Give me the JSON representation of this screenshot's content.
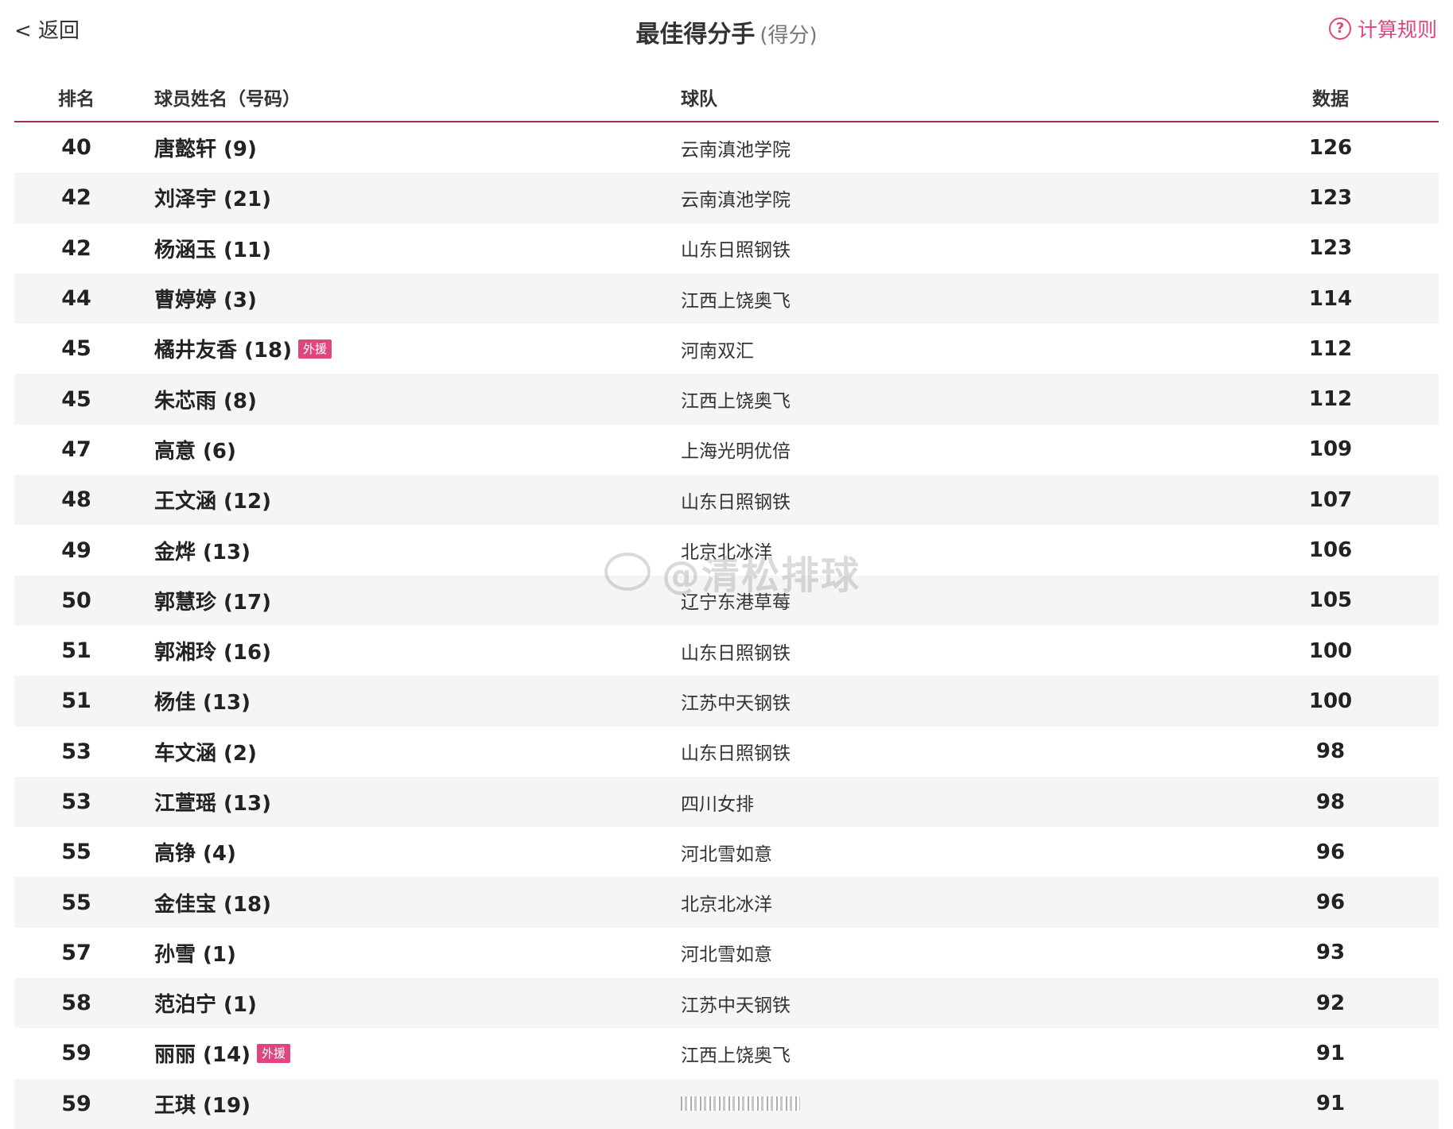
{
  "header": {
    "back_label": "< 返回",
    "title": "最佳得分手",
    "subtitle": "(得分)",
    "rules_icon": "question-circle-icon",
    "rules_label": "计算规则"
  },
  "table": {
    "columns": [
      "排名",
      "球员姓名（号码）",
      "球队",
      "数据"
    ],
    "rows": [
      {
        "rank": "40",
        "name": "唐懿轩 (9)",
        "foreign": "",
        "team": "云南滇池学院",
        "value": "126"
      },
      {
        "rank": "42",
        "name": "刘泽宇 (21)",
        "foreign": "",
        "team": "云南滇池学院",
        "value": "123"
      },
      {
        "rank": "42",
        "name": "杨涵玉 (11)",
        "foreign": "",
        "team": "山东日照钢铁",
        "value": "123"
      },
      {
        "rank": "44",
        "name": "曹婷婷 (3)",
        "foreign": "",
        "team": "江西上饶奥飞",
        "value": "114"
      },
      {
        "rank": "45",
        "name": "橘井友香 (18)",
        "foreign": "外援",
        "team": "河南双汇",
        "value": "112"
      },
      {
        "rank": "45",
        "name": "朱芯雨 (8)",
        "foreign": "",
        "team": "江西上饶奥飞",
        "value": "112"
      },
      {
        "rank": "47",
        "name": "高意 (6)",
        "foreign": "",
        "team": "上海光明优倍",
        "value": "109"
      },
      {
        "rank": "48",
        "name": "王文涵 (12)",
        "foreign": "",
        "team": "山东日照钢铁",
        "value": "107"
      },
      {
        "rank": "49",
        "name": "金烨 (13)",
        "foreign": "",
        "team": "北京北冰洋",
        "value": "106"
      },
      {
        "rank": "50",
        "name": "郭慧珍 (17)",
        "foreign": "",
        "team": "辽宁东港草莓",
        "value": "105"
      },
      {
        "rank": "51",
        "name": "郭湘玲 (16)",
        "foreign": "",
        "team": "山东日照钢铁",
        "value": "100"
      },
      {
        "rank": "51",
        "name": "杨佳 (13)",
        "foreign": "",
        "team": "江苏中天钢铁",
        "value": "100"
      },
      {
        "rank": "53",
        "name": "车文涵 (2)",
        "foreign": "",
        "team": "山东日照钢铁",
        "value": "98"
      },
      {
        "rank": "53",
        "name": "江萱瑶 (13)",
        "foreign": "",
        "team": "四川女排",
        "value": "98"
      },
      {
        "rank": "55",
        "name": "高铮 (4)",
        "foreign": "",
        "team": "河北雪如意",
        "value": "96"
      },
      {
        "rank": "55",
        "name": "金佳宝 (18)",
        "foreign": "",
        "team": "北京北冰洋",
        "value": "96"
      },
      {
        "rank": "57",
        "name": "孙雪 (1)",
        "foreign": "",
        "team": "河北雪如意",
        "value": "93"
      },
      {
        "rank": "58",
        "name": "范泊宁 (1)",
        "foreign": "",
        "team": "江苏中天钢铁",
        "value": "92"
      },
      {
        "rank": "59",
        "name": "丽丽 (14)",
        "foreign": "外援",
        "team": "江西上饶奥飞",
        "value": "91"
      },
      {
        "rank": "59",
        "name": "王琪 (19)",
        "foreign": "",
        "team": "",
        "value": "91"
      }
    ]
  },
  "watermark": "@清松排球"
}
